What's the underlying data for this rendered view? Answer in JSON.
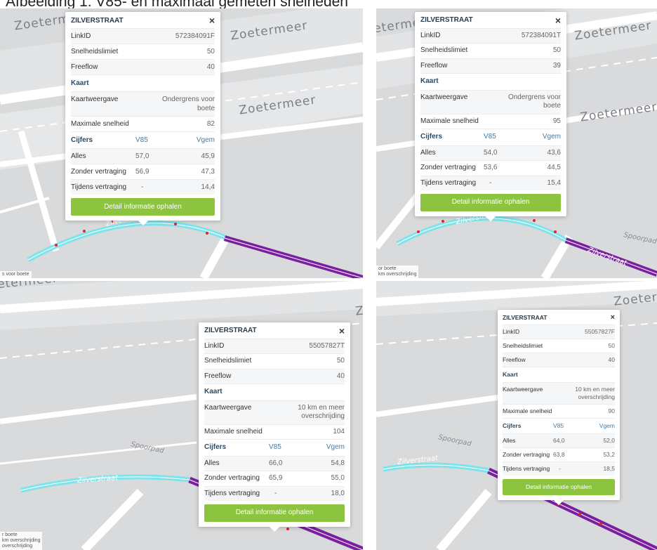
{
  "caption": "Afbeelding 1: V85- en maximaal gemeten snelheden",
  "colors": {
    "button": "#8cc43f",
    "road_cyan": "#7ee3ea",
    "road_purple": "#7a1fa0",
    "arrow_red": "#e0242d",
    "map_bg": "#d9dadb"
  },
  "icons": {
    "close": "close-icon"
  },
  "panels": [
    {
      "place_labels": [
        "Zoetermeer",
        "Zoetermeer",
        "Zoetermeer"
      ],
      "street_labels": [
        "Zilverstraat"
      ],
      "legend": [
        "s voor boete"
      ],
      "popup": {
        "title": "ZILVERSTRAAT",
        "close": "×",
        "rows": [
          {
            "label": "LinkID",
            "value": "572384091F"
          },
          {
            "label": "Snelheidslimiet",
            "value": "50"
          },
          {
            "label": "Freeflow",
            "value": "40"
          }
        ],
        "map_section": "Kaart",
        "map_rows": [
          {
            "label": "Kaartweergave",
            "value": "Ondergrens voor boete"
          },
          {
            "label": "Maximale snelheid",
            "value": "82"
          }
        ],
        "stats_header": [
          "Cijfers",
          "V85",
          "Vgem"
        ],
        "stats": [
          [
            "Alles",
            "57,0",
            "45,9"
          ],
          [
            "Zonder vertraging",
            "56,9",
            "47,3"
          ],
          [
            "Tijdens vertraging",
            "-",
            "14,4"
          ]
        ],
        "button": "Detail informatie ophalen"
      }
    },
    {
      "place_labels": [
        "Zoetermeer",
        "Zoetermeer",
        "Zoetermeer"
      ],
      "street_labels": [
        "Zilverstraat",
        "Zilverstraat",
        "Spoorpad"
      ],
      "legend": [
        "or boete",
        "km overschrijding"
      ],
      "popup": {
        "title": "ZILVERSTRAAT",
        "close": "×",
        "rows": [
          {
            "label": "LinkID",
            "value": "572384091T"
          },
          {
            "label": "Snelheidslimiet",
            "value": "50"
          },
          {
            "label": "Freeflow",
            "value": "39"
          }
        ],
        "map_section": "Kaart",
        "map_rows": [
          {
            "label": "Kaartweergave",
            "value": "Ondergrens voor boete"
          },
          {
            "label": "Maximale snelheid",
            "value": "95"
          }
        ],
        "stats_header": [
          "Cijfers",
          "V85",
          "Vgem"
        ],
        "stats": [
          [
            "Alles",
            "54,0",
            "43,6"
          ],
          [
            "Zonder vertraging",
            "53,6",
            "44,5"
          ],
          [
            "Tijdens vertraging",
            "-",
            "15,4"
          ]
        ],
        "button": "Detail informatie ophalen"
      }
    },
    {
      "place_labels": [
        "Zoetermeer",
        "Zoetermeer"
      ],
      "street_labels": [
        "Spoorpad",
        "Zilverstraat"
      ],
      "legend": [
        "r boete",
        "km overschrijding",
        "overschrijding"
      ],
      "popup": {
        "title": "ZILVERSTRAAT",
        "close": "×",
        "rows": [
          {
            "label": "LinkID",
            "value": "55057827T"
          },
          {
            "label": "Snelheidslimiet",
            "value": "50"
          },
          {
            "label": "Freeflow",
            "value": "40"
          }
        ],
        "map_section": "Kaart",
        "map_rows": [
          {
            "label": "Kaartweergave",
            "value": "10 km en meer overschrijding"
          },
          {
            "label": "Maximale snelheid",
            "value": "104"
          }
        ],
        "stats_header": [
          "Cijfers",
          "V85",
          "Vgem"
        ],
        "stats": [
          [
            "Alles",
            "66,0",
            "54,8"
          ],
          [
            "Zonder vertraging",
            "65,9",
            "55,0"
          ],
          [
            "Tijdens vertraging",
            "-",
            "18,0"
          ]
        ],
        "button": "Detail informatie ophalen"
      }
    },
    {
      "place_labels": [
        "Zoetermeer"
      ],
      "street_labels": [
        "Spoorpad",
        "Zilverstraat"
      ],
      "legend": [],
      "popup": {
        "title": "ZILVERSTRAAT",
        "close": "×",
        "rows": [
          {
            "label": "LinkID",
            "value": "55057827F"
          },
          {
            "label": "Snelheidslimiet",
            "value": "50"
          },
          {
            "label": "Freeflow",
            "value": "40"
          }
        ],
        "map_section": "Kaart",
        "map_rows": [
          {
            "label": "Kaartweergave",
            "value": "10 km en meer overschrijding"
          },
          {
            "label": "Maximale snelheid",
            "value": "90"
          }
        ],
        "stats_header": [
          "Cijfers",
          "V85",
          "Vgem"
        ],
        "stats": [
          [
            "Alles",
            "64,0",
            "52,0"
          ],
          [
            "Zonder vertraging",
            "63,8",
            "53,2"
          ],
          [
            "Tijdens vertraging",
            "-",
            "18,5"
          ]
        ],
        "button": "Detail informatie ophalen"
      }
    }
  ]
}
